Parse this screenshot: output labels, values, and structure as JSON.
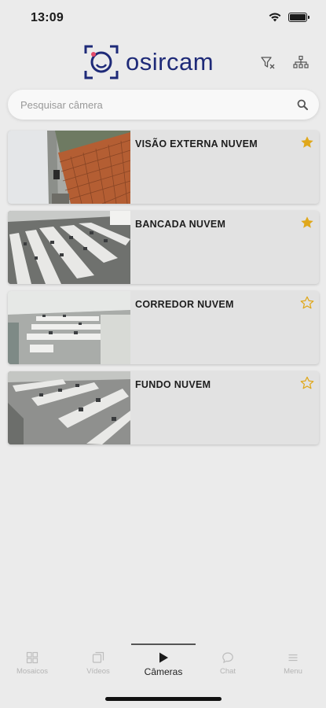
{
  "status_bar": {
    "time": "13:09"
  },
  "header": {
    "logo_text": "osircam"
  },
  "search": {
    "placeholder": "Pesquisar câmera"
  },
  "cameras": [
    {
      "name": "VISÃO EXTERNA NUVEM",
      "favorite": true
    },
    {
      "name": "BANCADA NUVEM",
      "favorite": true
    },
    {
      "name": "CORREDOR NUVEM",
      "favorite": false
    },
    {
      "name": "FUNDO NUVEM",
      "favorite": false
    }
  ],
  "tabs": [
    {
      "label": "Mosaicos",
      "icon": "grid-icon",
      "active": false
    },
    {
      "label": "Vídeos",
      "icon": "videos-icon",
      "active": false
    },
    {
      "label": "Câmeras",
      "icon": "play-icon",
      "active": true
    },
    {
      "label": "Chat",
      "icon": "chat-icon",
      "active": false
    },
    {
      "label": "Menu",
      "icon": "menu-icon",
      "active": false
    }
  ],
  "colors": {
    "brand": "#1e2a78",
    "star": "#e0a81c",
    "background": "#ebebeb",
    "card": "#e2e2e2"
  }
}
